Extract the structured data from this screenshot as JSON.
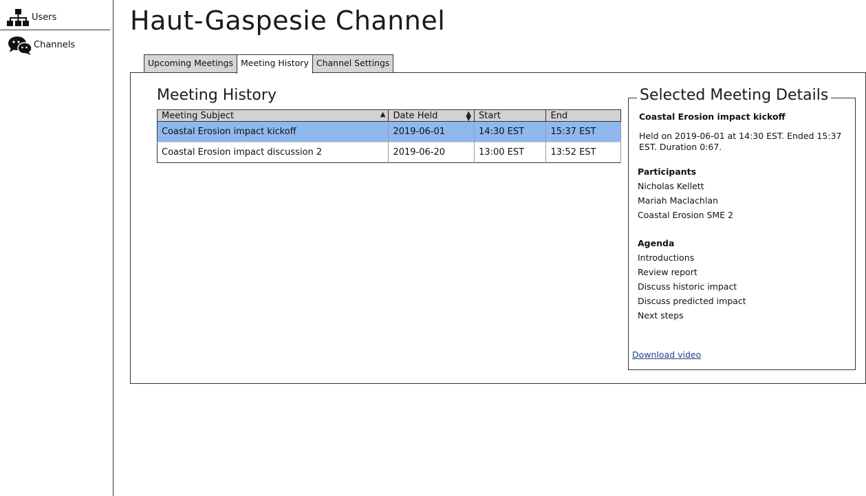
{
  "sidebar": {
    "items": [
      {
        "label": "Users",
        "icon": "org-chart-icon"
      },
      {
        "label": "Channels",
        "icon": "chat-bubbles-icon"
      }
    ]
  },
  "page": {
    "title": "Haut-Gaspesie Channel"
  },
  "tabs": [
    {
      "label": "Upcoming Meetings",
      "active": false
    },
    {
      "label": "Meeting History",
      "active": true
    },
    {
      "label": "Channel Settings",
      "active": false
    }
  ],
  "history": {
    "title": "Meeting History",
    "columns": [
      "Meeting Subject",
      "Date Held",
      "Start",
      "End"
    ],
    "rows": [
      {
        "subject": "Coastal Erosion impact kickoff",
        "date": "2019-06-01",
        "start": "14:30 EST",
        "end": "15:37 EST",
        "selected": true
      },
      {
        "subject": "Coastal Erosion impact discussion 2",
        "date": "2019-06-20",
        "start": "13:00 EST",
        "end": "13:52 EST",
        "selected": false
      }
    ]
  },
  "details": {
    "title": "Selected Meeting Details",
    "meeting_name": "Coastal Erosion impact kickoff",
    "description": "Held on 2019-06-01 at 14:30 EST. Ended 15:37 EST. Duration 0:67.",
    "participants_heading": "Participants",
    "participants": [
      "Nicholas Kellett",
      "Mariah Maclachlan",
      "Coastal Erosion SME 2"
    ],
    "agenda_heading": "Agenda",
    "agenda": [
      "Introductions",
      "Review report",
      "Discuss historic impact",
      "Discuss predicted impact",
      "Next steps"
    ],
    "download_label": "Download video"
  },
  "colors": {
    "selected_row": "#8fb8ee",
    "header_bg": "#d2d2d2",
    "tab_inactive": "#d6d6d6",
    "link": "#1c3f8a"
  }
}
